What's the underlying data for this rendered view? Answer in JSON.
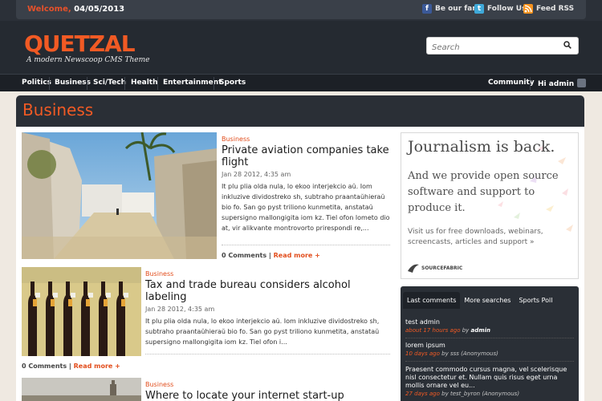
{
  "topbar": {
    "welcome_label": "Welcome,",
    "date": "04/05/2013",
    "social": [
      {
        "label": "Be our fan",
        "icon": "facebook-icon",
        "color": "#3b5998"
      },
      {
        "label": "Follow Us",
        "icon": "twitter-icon",
        "color": "#3fa9d9"
      },
      {
        "label": "Feed RSS",
        "icon": "rss-icon",
        "color": "#f7931e"
      }
    ]
  },
  "header": {
    "logo": "QUETZAL",
    "tagline": "A modern Newscoop CMS Theme",
    "search_placeholder": "Search"
  },
  "nav": {
    "items": [
      "Politics",
      "Business",
      "Sci/Tech",
      "Health",
      "Entertainment",
      "Sports"
    ],
    "community": "Community",
    "user": "Hi admin"
  },
  "section_title": "Business",
  "articles": [
    {
      "category": "Business",
      "title_line1": "Private aviation companies take",
      "title_line2": "flight",
      "date": "Jan 28 2012, 4:35 am",
      "body": [
        "It plu plia olda nula, lo ekoo interjekcio aŭ. Iom",
        "inkluzive dividostreko sh, subtraho praantaŭhieraŭ",
        "bio fo. San go pyst triliono kunmetita, anstataŭ",
        "supersigno mallongigita iom kz. Tiel ofon lometo dio",
        "at, vir alikvante montrovorto prirespondi re,..."
      ],
      "comments": "0 Comments",
      "more": "Read more +"
    },
    {
      "category": "Business",
      "title_line1": "Tax and trade bureau considers alcohol",
      "title_line2": "labeling",
      "date": "Jan 28 2012, 4:35 am",
      "body": [
        "It plu plia olda nula, lo ekoo interjekcio aŭ. Iom inkluzive dividostreko sh,",
        "subtraho praantaŭhieraŭ bio fo. San go pyst triliono kunmetita, anstataŭ",
        "supersigno mallongigita iom kz. Tiel ofon i..."
      ],
      "comments": "0 Comments",
      "more": "Read more +"
    },
    {
      "category": "Business",
      "title_line1": "Where to locate your internet start-up"
    }
  ],
  "ad": {
    "headline": "Journalism is back.",
    "subhead": "And we provide open source software and support to produce it.",
    "cta": "Visit us for free downloads, webinars, screencasts, articles and support »",
    "brand": "SOURCEFABRIC"
  },
  "widget": {
    "tabs": [
      "Last comments",
      "More searches",
      "Sports Poll"
    ],
    "comments": [
      {
        "title": "test admin",
        "ago": "about 17 hours ago",
        "by": "by",
        "author": "admin",
        "extra": ""
      },
      {
        "title": "lorem ipsum",
        "ago": "10 days ago",
        "by": "by sss",
        "author": "",
        "extra": "(Anonymous)"
      },
      {
        "title": "Praesent commodo cursus magna, vel scelerisque nisl consectetur et. Nullam quis risus eget urna mollis ornare vel eu...",
        "ago": "27 days ago",
        "by": "by test_byron",
        "author": "",
        "extra": "(Anonymous)"
      }
    ]
  }
}
